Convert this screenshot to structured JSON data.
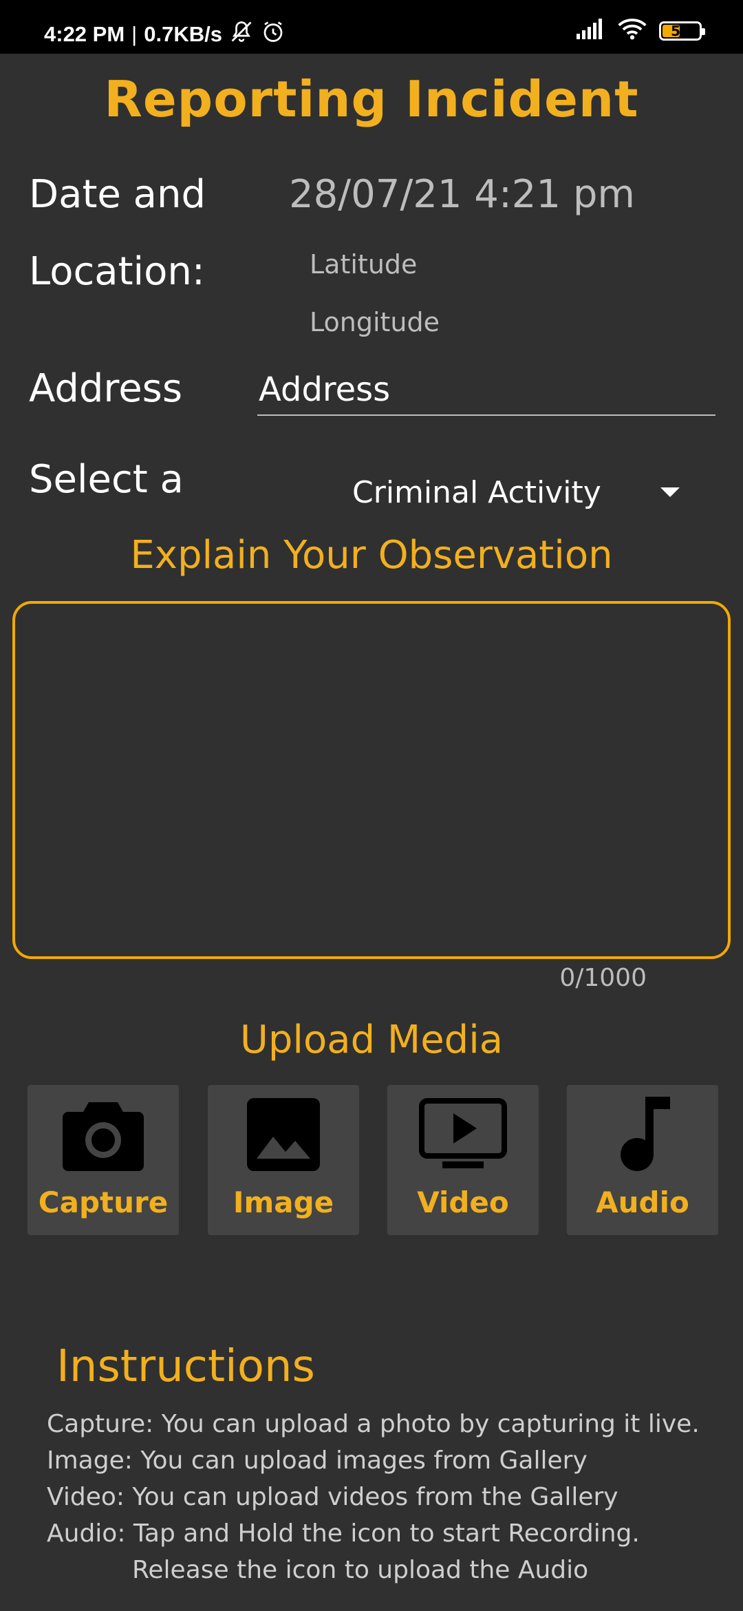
{
  "status_bar": {
    "time": "4:22 PM",
    "separator": "|",
    "speed": "0.7KB/s",
    "battery": "52"
  },
  "page": {
    "title": "Reporting Incident"
  },
  "form": {
    "date_label": "Date and",
    "date_value": "28/07/21 4:21 pm",
    "location_label": "Location:",
    "latitude_placeholder": "Latitude",
    "longitude_placeholder": "Longitude",
    "address_label": "Address",
    "address_value": "Address",
    "category_label": "Select a",
    "category_value": "Criminal Activity",
    "observation_title": "Explain Your Observation",
    "observation_counter": "0/1000"
  },
  "media": {
    "title": "Upload Media",
    "buttons": [
      {
        "label": "Capture",
        "icon": "camera-icon"
      },
      {
        "label": "Image",
        "icon": "image-icon"
      },
      {
        "label": "Video",
        "icon": "video-icon"
      },
      {
        "label": "Audio",
        "icon": "music-note-icon"
      }
    ]
  },
  "instructions": {
    "title": "Instructions",
    "lines": [
      "Capture: You can upload a photo by capturing it live.",
      "Image: You can upload images from Gallery",
      "Video: You can upload videos from the Gallery",
      "Audio: Tap and Hold the icon to start Recording.",
      "Release the icon to upload the Audio"
    ]
  },
  "colors": {
    "accent": "#f2b01e",
    "background": "#303030",
    "button_background": "#444444",
    "status_bar": "#000000"
  }
}
